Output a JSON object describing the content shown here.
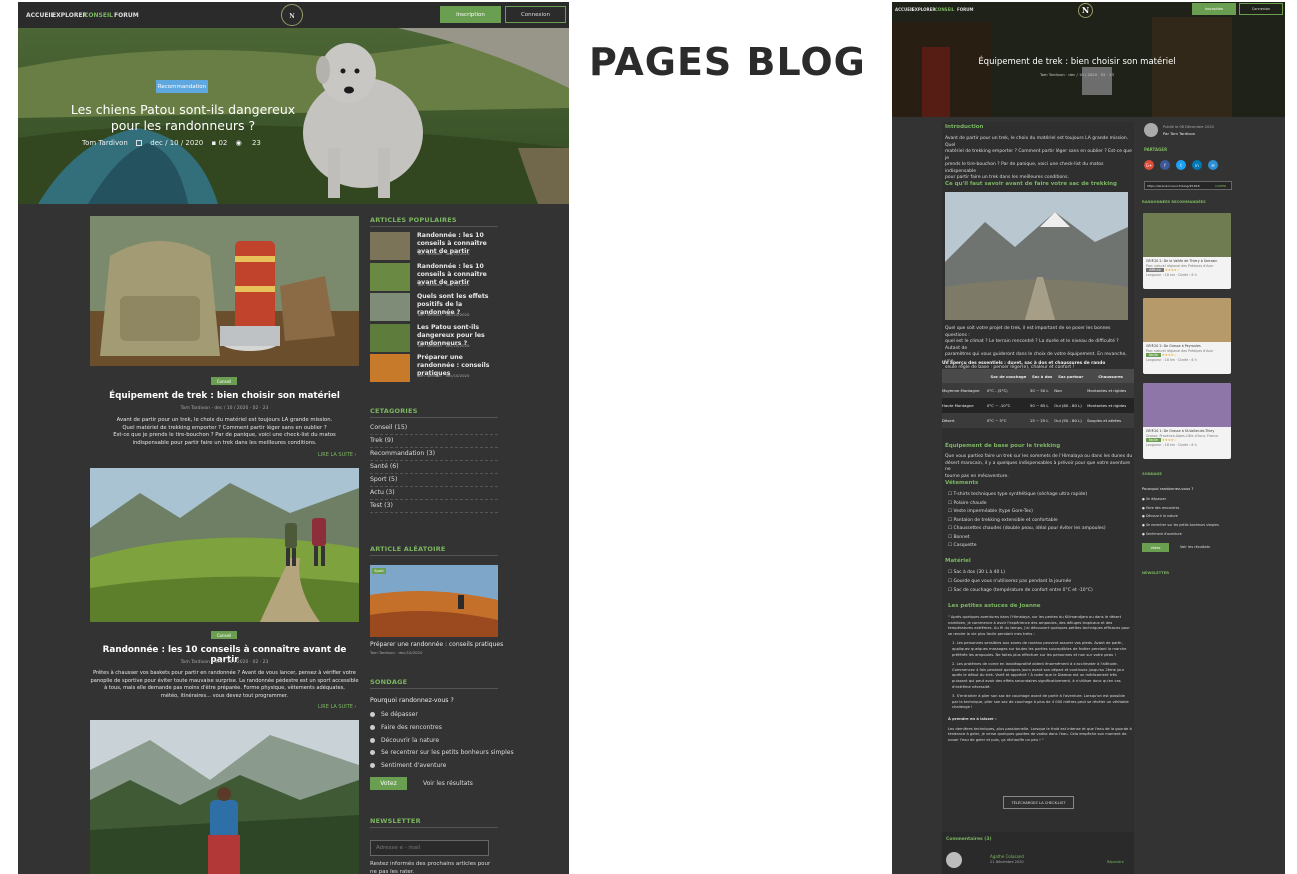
{
  "title": "PAGES BLOG",
  "colors": {
    "accent": "#7bb661",
    "bg": "#333333",
    "nav": "#2b2b2b"
  },
  "left": {
    "nav": {
      "items": [
        "ACCUEIL",
        "EXPLORER",
        "CONSEIL",
        "FORUM"
      ],
      "logo": "N",
      "signup": "Inscription",
      "login": "Connexion"
    },
    "hero": {
      "badge": "Recommandation",
      "title_line1": "Les chiens Patou sont-ils dangereux",
      "title_line2": "pour les randonneurs ?",
      "author": "Tom Tardivon",
      "date": "dec / 10 / 2020",
      "comments": "02",
      "views": "23"
    },
    "articles": [
      {
        "badge": "Conseil",
        "title": "Équipement de trek : bien choisir son matériel",
        "meta": "Tom Tardivon  ·  dec / 10 / 2020  ·  02  ·  23",
        "excerpt": [
          "Avant de partir pour un trek, le choix du matériel est toujours LA grande mission.",
          "Quel matériel de trekking emporter ? Comment partir léger sans en oublier ?",
          "Est-ce que je prends le tire-bouchon ? Par de panique, voici une check-list du matos",
          "indispensable pour partir faire un trek dans les meilleures conditions."
        ],
        "more": "LIRE LA SUITE"
      },
      {
        "badge": "Conseil",
        "title": "Randonnée : les 10 conseils à connaître avant de partir",
        "meta": "Tom Tardivon  ·  dec / 10 / 2020  ·  02  ·  23",
        "excerpt": [
          "Prêtes à chausser vos baskets pour partir en randonnée ? Avant de vous lancer, pensez à vérifier votre",
          "panoplie de sportive pour éviter toute mauvaise surprise. La randonnée pédestre est un sport accessible",
          "à tous, mais elle demande pas moins d'être préparée. Forme physique, vêtements adéquates,",
          "météo, itinéraires... vous devez tout programmer."
        ],
        "more": "LIRE LA SUITE"
      }
    ],
    "sidebar": {
      "popular_title": "ARTICLES POPULAIRES",
      "popular": [
        {
          "title": "Randonnée : les 10 conseils à connaître avant de partir",
          "meta": "Tom Tardivon  ·  dec/10/2020"
        },
        {
          "title": "Randonnée : les 10 conseils à connaître avant de partir",
          "meta": "Tom Tardivon  ·  dec/10/2020"
        },
        {
          "title": "Quels sont les effets positifs de la randonnée ?",
          "meta": "Tom Tardivon  ·  dec/10/2020"
        },
        {
          "title": "Les Patou sont-ils dangereux pour les randonneurs ?",
          "meta": "Tom Tardivon  ·  dec/10/2020"
        },
        {
          "title": "Préparer une randonnée : conseils pratiques",
          "meta": "Tom Tardivon  ·  dec/10/2020"
        }
      ],
      "categories_title": "CETAGORIES",
      "categories": [
        {
          "name": "Conseil",
          "count": "(15)"
        },
        {
          "name": "Trek",
          "count": "(9)"
        },
        {
          "name": "Recommandation",
          "count": "(3)"
        },
        {
          "name": "Santé",
          "count": "(6)"
        },
        {
          "name": "Sport",
          "count": "(5)"
        },
        {
          "name": "Actu",
          "count": "(3)"
        },
        {
          "name": "Test",
          "count": "(3)"
        }
      ],
      "random_title": "ARTICLE ALÉATOIRE",
      "random": {
        "badge": "Sport",
        "title": "Préparer une randonnée : conseils pratiques",
        "meta": "Tom Tardivon  ·  dec/10/2020"
      },
      "poll_title": "SONDAGE",
      "poll_question": "Pourquoi randonnez-vous ?",
      "poll_options": [
        "Se dépasser",
        "Faire des rencontres",
        "Découvrir la nature",
        "Se recentrer sur les petits bonheurs simples",
        "Sentiment d'aventure"
      ],
      "vote": "Votez",
      "results": "Voir les résultats",
      "newsletter_title": "NEWSLETTER",
      "newsletter_placeholder": "Adresse e - mail",
      "newsletter_text": "Restez informés des prochains articles pour ne pas les rater."
    }
  },
  "right": {
    "nav": {
      "items": [
        "ACCUEIL",
        "EXPLORER",
        "CONSEIL",
        "FORUM"
      ],
      "logo": "N",
      "signup": "Inscription",
      "login": "Connexion"
    },
    "hero": {
      "title": "Équipement de trek : bien choisir son matériel",
      "meta": "Tom Tardivon  ·  dec / 10 / 2020  ·  02  ·  23"
    },
    "intro_title": "Introduction",
    "intro": [
      "Avant de partir pour un trek, le choix du matériel est toujours LA grande mission. Quel",
      "matériel de trekking emporter ? Comment partir léger sans en oublier ? Est-ce que je",
      "prends le tire-bouchon ? Par de panique, voici une check-list du matos indispensable",
      "pour partir faire un trek dans les meilleures conditions."
    ],
    "section1_title": "Ce qu'il faut savoir avant de faire votre sac de trekking",
    "section1": [
      "Quel que soit votre projet de trek, il est important de se poser les bonnes questions :",
      "quel est le climat ? Le terrain rencontré ? La durée et le niveau de difficulté ? Autant de",
      "paramètres qui vous guideront dans le choix de votre équipement. En revanche, une",
      "seule règle de base : penser léger(e), chaleur et confort !"
    ],
    "table_caption": "Un aperçu des essentiels : duvet, sac à dos et chaussures de rando",
    "table_headers": [
      "",
      "Sac de couchage",
      "Sac à dos",
      "Sac portour",
      "Chaussures"
    ],
    "table_rows": [
      [
        "Moyenne Montagne",
        "0°C - (5°C)",
        "30 ~ 50 L",
        "Non",
        "Montantes et rigides"
      ],
      [
        "Haute Montagne",
        "0°C ~ -10°C",
        "50 ~ 65 L",
        "Oui (60 - 80 L)",
        "Montantes et rigides"
      ],
      [
        "Désert",
        "0°C ~ 5°C",
        "15 ~ 25 L",
        "Oui (50 - 80 L)",
        "Souples et aérées"
      ]
    ],
    "section2_title": "Équipement de base pour le trekking",
    "section2": [
      "Que vous partiez faire un trek sur les sommets de l'Himalaya ou dans les dunes du",
      "désert marocain, il y a quelques indispensables à prévoir pour que votre aventure ne",
      "tourne pas en mésaventure."
    ],
    "clothes_title": "Vêtements",
    "clothes": [
      "T-shirts techniques type synthétique (séchage ultra rapide)",
      "Polaire chaude",
      "Veste imperméable (type Gore-Tex)",
      "Pantalon de trekking extensible et confortable",
      "Chaussettes chaudes (double peau, idéal pour éviter les ampoules)",
      "Bonnet",
      "Casquette"
    ],
    "gear_title": "Matériel",
    "gear": [
      "Sac à dos (30 L à 40 L)",
      "Gourde que vous n'utiliserez pas pendant la journée",
      "Sac de couchage (température de confort entre 0°C et -10°C)"
    ],
    "tips_title": "Les petites astuces de Joanne",
    "tips": [
      "\" Après quelques aventures dans l'Himalaya, sur les pentes du Kilimandjaro ou dans le désert namibien, je commence à avoir l'expérience des ampoules, des déluges tropicaux et des températures extrêmes. Au fil du temps, j'ai découvert quelques petites techniques efficaces pour se rendre la vie plus facile pendant mes treks :",
      "1. Les personnes sensibles aux zones de rouleau peuvent assurer vos pieds. Avant de partir, appliquez quelques massages sur toutes les parties susceptibles de frotter pendant la marche préférée les ampoules. Ne faites plus effectuer sur les personnes et non sur votre peau !",
      "2. Les protéines de corne en lanoléoprothé aident énormément à s'acclimater à l'altitude. Commencez 4 fois pendant quelques jours avant son départ et continuez jusqu'au 2ème jour après le début du trek. Varié et apprécié ! À noter que le Diamox est un médicament très puissant qui peut avoir des effets secondaires significativement, à n'utiliser donc qu'en cas d'extrême nécessité.",
      "3. S'entraîner à plier son sac de couchage avant de partir à l'aventure. Lorsqu'on est possible par la technique, plier son sac de couchage à plus de 4 000 mètres peut se révéler un véritable challenge !",
      "À prendre en à laisser :",
      "Les dernières techniques, plus passionnelle. Lorsque le froid est intense et que l'eau de la gourde à tendance à geler, je verse quelques gouttes de vodka dans l'eau. Cela empêche son moment de nouer l'eau de geler et puis, ça réchauffe un peu ! \""
    ],
    "download": "TÉLÉCHARGEZ LA CHECK-LIST",
    "comments_title": "Commentaires (3)",
    "comment": {
      "author": "Agathe Colasand",
      "date": "21 Décembre 2020",
      "reply": "Répondre"
    },
    "sidebar": {
      "published": "Publié le 08 Décembre 2020",
      "by": "Par Tom Tardivon",
      "share_title": "PARTAGER",
      "social": [
        "G+",
        "f",
        "t",
        "in",
        "✉"
      ],
      "link": "https://lerandonneur.fr/blog/#1818",
      "copy": "COPIER",
      "recommended_title": "RANDONNÉES RECOMMANDÉES",
      "treks": [
        {
          "title": "GR®20 2: De la Vallée de Thiery à Sarrasin",
          "sub": "Parc naturel régional des Préalpes d'Azur",
          "level": "difficile",
          "stars": "★★★★☆",
          "meta": "Longueur : 18 km  ·  Durée : 6 h"
        },
        {
          "title": "GR®20 2: De Grasse à Peyroules",
          "sub": "Parc naturel régional des Préalpes d'Azur",
          "level": "facile",
          "stars": "★★★★☆",
          "meta": "Longueur : 18 km  ·  Durée : 6 h"
        },
        {
          "title": "GR®20 1: De Grasse à St-Vallier-de-Thiey",
          "sub": "Grasse, Provence-Alpes-Côte d'Azur, France",
          "level": "facile",
          "stars": "★★★★☆",
          "meta": "Longueur : 18 km  ·  Durée : 6 h"
        }
      ],
      "poll_title": "SONDAGE",
      "poll_question": "Pourquoi randonnez-vous ?",
      "poll_options": [
        "Se dépasser",
        "Faire des rencontres",
        "Découvrir la nature",
        "Se recentrer sur les petits bonheurs simples",
        "Sentiment d'aventure"
      ],
      "vote": "Votez",
      "results": "Voir les résultats",
      "newsletter_title": "NEWSLETTER"
    }
  }
}
